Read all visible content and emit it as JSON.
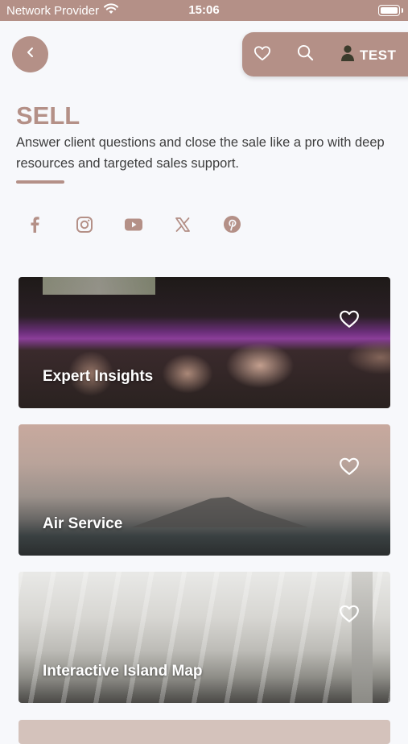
{
  "status_bar": {
    "carrier": "Network Provider",
    "time": "15:06"
  },
  "header": {
    "user_label": "TEST"
  },
  "page": {
    "title": "SELL",
    "description": "Answer client questions and close the sale like a pro with deep resources and targeted sales support."
  },
  "social_icons": [
    "facebook-icon",
    "instagram-icon",
    "youtube-icon",
    "x-icon",
    "pinterest-icon"
  ],
  "cards": [
    {
      "title": "Expert Insights"
    },
    {
      "title": "Air Service"
    },
    {
      "title": "Interactive Island Map"
    }
  ],
  "colors": {
    "accent": "#b49087",
    "background": "#f7f8fb",
    "text": "#3d3d3d"
  }
}
